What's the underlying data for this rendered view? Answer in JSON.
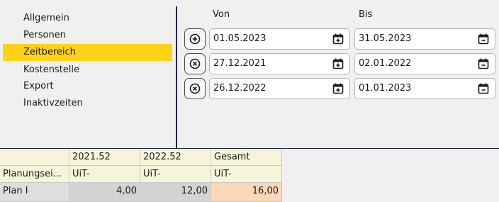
{
  "sidebar": {
    "items": [
      {
        "label": "Allgemein"
      },
      {
        "label": "Personen"
      },
      {
        "label": "Zeitbereich",
        "active": true
      },
      {
        "label": "Kostenstelle"
      },
      {
        "label": "Export"
      },
      {
        "label": "Inaktivzeiten"
      }
    ]
  },
  "ranges": {
    "von_label": "Von",
    "bis_label": "Bis",
    "rows": [
      {
        "action_icon": "plus-circle-icon",
        "von": "01.05.2023",
        "von_icon": "calendar-plus-icon",
        "bis": "31.05.2023",
        "bis_icon": "calendar-minus-icon"
      },
      {
        "action_icon": "x-circle-icon",
        "von": "27.12.2021",
        "von_icon": "calendar-plus-icon",
        "bis": "02.01.2022",
        "bis_icon": "calendar-minus-icon"
      },
      {
        "action_icon": "x-circle-icon",
        "von": "26.12.2022",
        "von_icon": "calendar-plus-icon",
        "bis": "01.01.2023",
        "bis_icon": "calendar-minus-icon"
      }
    ]
  },
  "grid": {
    "header": [
      "",
      "2021.52",
      "2022.52",
      "Gesamt"
    ],
    "rows": [
      [
        "Planungsei...",
        "UiT-",
        "UiT-",
        "UiT-"
      ],
      [
        "Plan I",
        "4,00",
        "12,00",
        "16,00"
      ]
    ]
  },
  "colors": {
    "accent": "#ffd21a",
    "divider": "#1f2a44",
    "cream": "#f6f5da",
    "total": "#fcd8b8"
  }
}
